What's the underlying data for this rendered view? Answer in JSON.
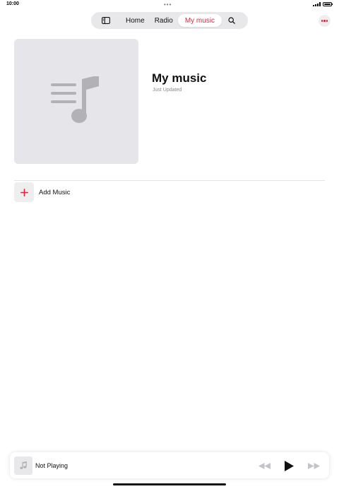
{
  "status_bar": {
    "time": "10:00",
    "center_dots": "•••",
    "icons": [
      "signal-icon",
      "battery-icon"
    ]
  },
  "nav": {
    "tabs": [
      {
        "label": "Home"
      },
      {
        "label": "Radio"
      },
      {
        "label": "My music",
        "active": true
      }
    ],
    "icons": [
      "sidebar-icon",
      "search-icon",
      "more-icon"
    ],
    "accent_color": "#e0243f",
    "pill_color": "#e8e8ea"
  },
  "playlist": {
    "title": "My music",
    "subtitle": "Just Updated",
    "artwork_icon": "music-note-list-icon"
  },
  "actions": {
    "add_music_label": "Add Music",
    "add_icon": "plus-icon"
  },
  "mini_player": {
    "status": "Not Playing",
    "icons": [
      "music-note-icon",
      "rewind-icon",
      "play-icon",
      "fast-forward-icon"
    ]
  }
}
